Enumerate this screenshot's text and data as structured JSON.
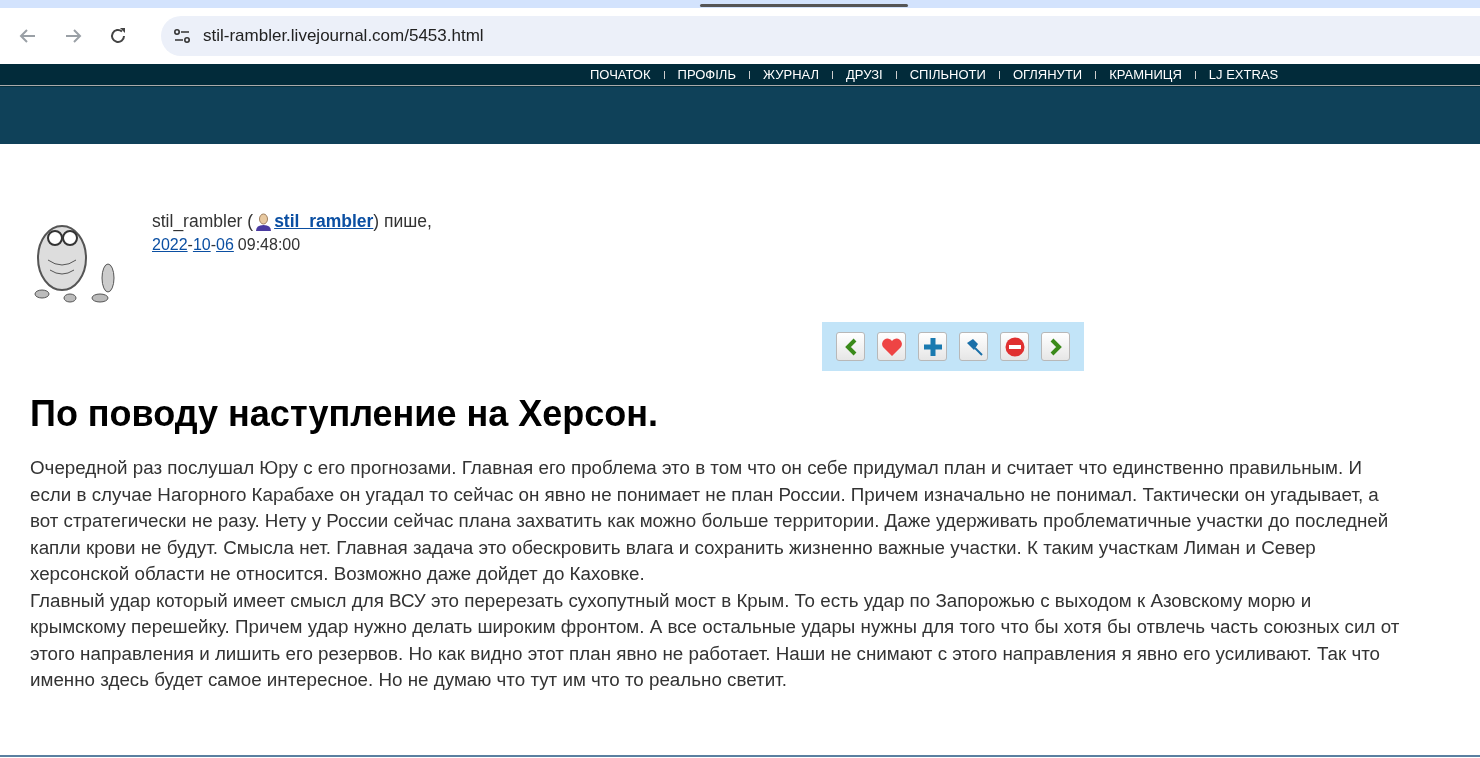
{
  "browser": {
    "url": "stil-rambler.livejournal.com/5453.html"
  },
  "nav": {
    "items": [
      "ПОЧАТОК",
      "ПРОФІЛЬ",
      "ЖУРНАЛ",
      "ДРУЗІ",
      "СПІЛЬНОТИ",
      "ОГЛЯНУТИ",
      "КРАМНИЦЯ",
      "LJ EXTRAS"
    ]
  },
  "post": {
    "author_name": "stil_rambler (",
    "author_link": "stil_rambler",
    "writes": ") пише,",
    "date_separators": [
      "-",
      "-"
    ],
    "date_parts": [
      "2022",
      "10",
      "06"
    ],
    "time": "09:48:00",
    "toolbar": [
      {
        "kind": "prev"
      },
      {
        "kind": "heart"
      },
      {
        "kind": "plus"
      },
      {
        "kind": "pin"
      },
      {
        "kind": "block"
      },
      {
        "kind": "next"
      }
    ],
    "title": "По поводу наступление на Херсон.",
    "paragraphs": [
      "Очередной раз послушал Юру с его прогнозами. Главная его проблема это в том что он себе придумал план и считает что единственно правильным. И если в случае Нагорного Карабахе он угадал то сейчас он явно не понимает не план России. Причем изначально не понимал. Тактически он угадывает, а вот стратегически не разу. Нету у России сейчас плана захватить как можно больше территории. Даже удерживать проблематичные участки до последней капли крови не будут. Смысла нет. Главная задача это обескровить влага и сохранить жизненно важные участки. К таким участкам Лиман и Север херсонской области не относится. Возможно даже дойдет до Каховке.",
      "Главный удар который имеет смысл для ВСУ это перерезать сухопутный мост в Крым. То есть удар по Запорожью с выходом к Азовскому морю и крымскому перешейку. Причем удар нужно делать широким фронтом. А все остальные удары нужны для того что бы хотя бы отвлечь часть союзных сил от этого направления и лишить его резервов. Но как видно этот план явно не работает. Наши не снимают с этого направления я явно его усиливают. Так что именно здесь будет самое интересное. Но не думаю что тут им что то реально светит."
    ]
  }
}
